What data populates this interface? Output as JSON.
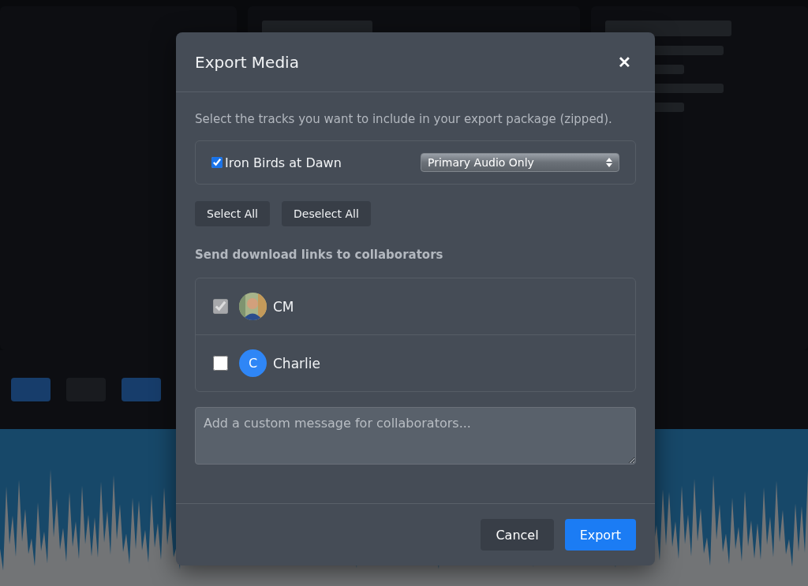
{
  "dialog": {
    "title": "Export Media",
    "close": "✕",
    "description": "Select the tracks you want to include in your export package (zipped).",
    "tracks": [
      {
        "name": "Iron Birds at Dawn",
        "checked": true,
        "option": "Primary Audio Only"
      }
    ],
    "track_buttons": [
      "Select All",
      "Deselect All"
    ],
    "collaborators_label": "Send download links to collaborators",
    "collaborators": [
      {
        "name": "CM",
        "checked": true,
        "disabled": true
      },
      {
        "name": "Charlie",
        "checked": false,
        "disabled": false,
        "avatar": {
          "kind": "initial",
          "initial": "C"
        }
      }
    ],
    "message": {
      "placeholder": "Add a custom message for collaborators..."
    },
    "footer_buttons": [
      {
        "label": "Cancel",
        "kind": "secondary"
      },
      {
        "label": "Export",
        "kind": "primary"
      }
    ]
  }
}
